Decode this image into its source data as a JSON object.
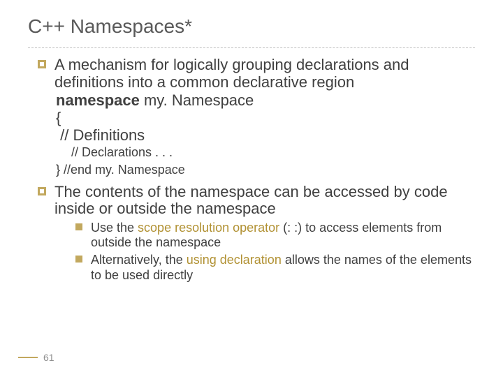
{
  "title": "C++ Namespaces*",
  "bullet1": {
    "intro": "A mechanism for logically grouping declarations and definitions into a common declarative region",
    "code_kw": "namespace",
    "code_name": " my. Namespace",
    "code_open": "{",
    "code_comment1": "// Definitions",
    "code_comment2": "// Declarations . . .",
    "code_close": "} //end my. Namespace"
  },
  "bullet2": {
    "text": "The contents of the namespace can be accessed by code inside or outside the namespace",
    "sub1_a": "Use the ",
    "sub1_hl": "scope resolution operator",
    "sub1_b": " (: :) to access elements from outside the namespace",
    "sub2_a": "Alternatively, the ",
    "sub2_hl": "using declaration",
    "sub2_b": " allows the names of the elements to be used directly"
  },
  "page": "61"
}
